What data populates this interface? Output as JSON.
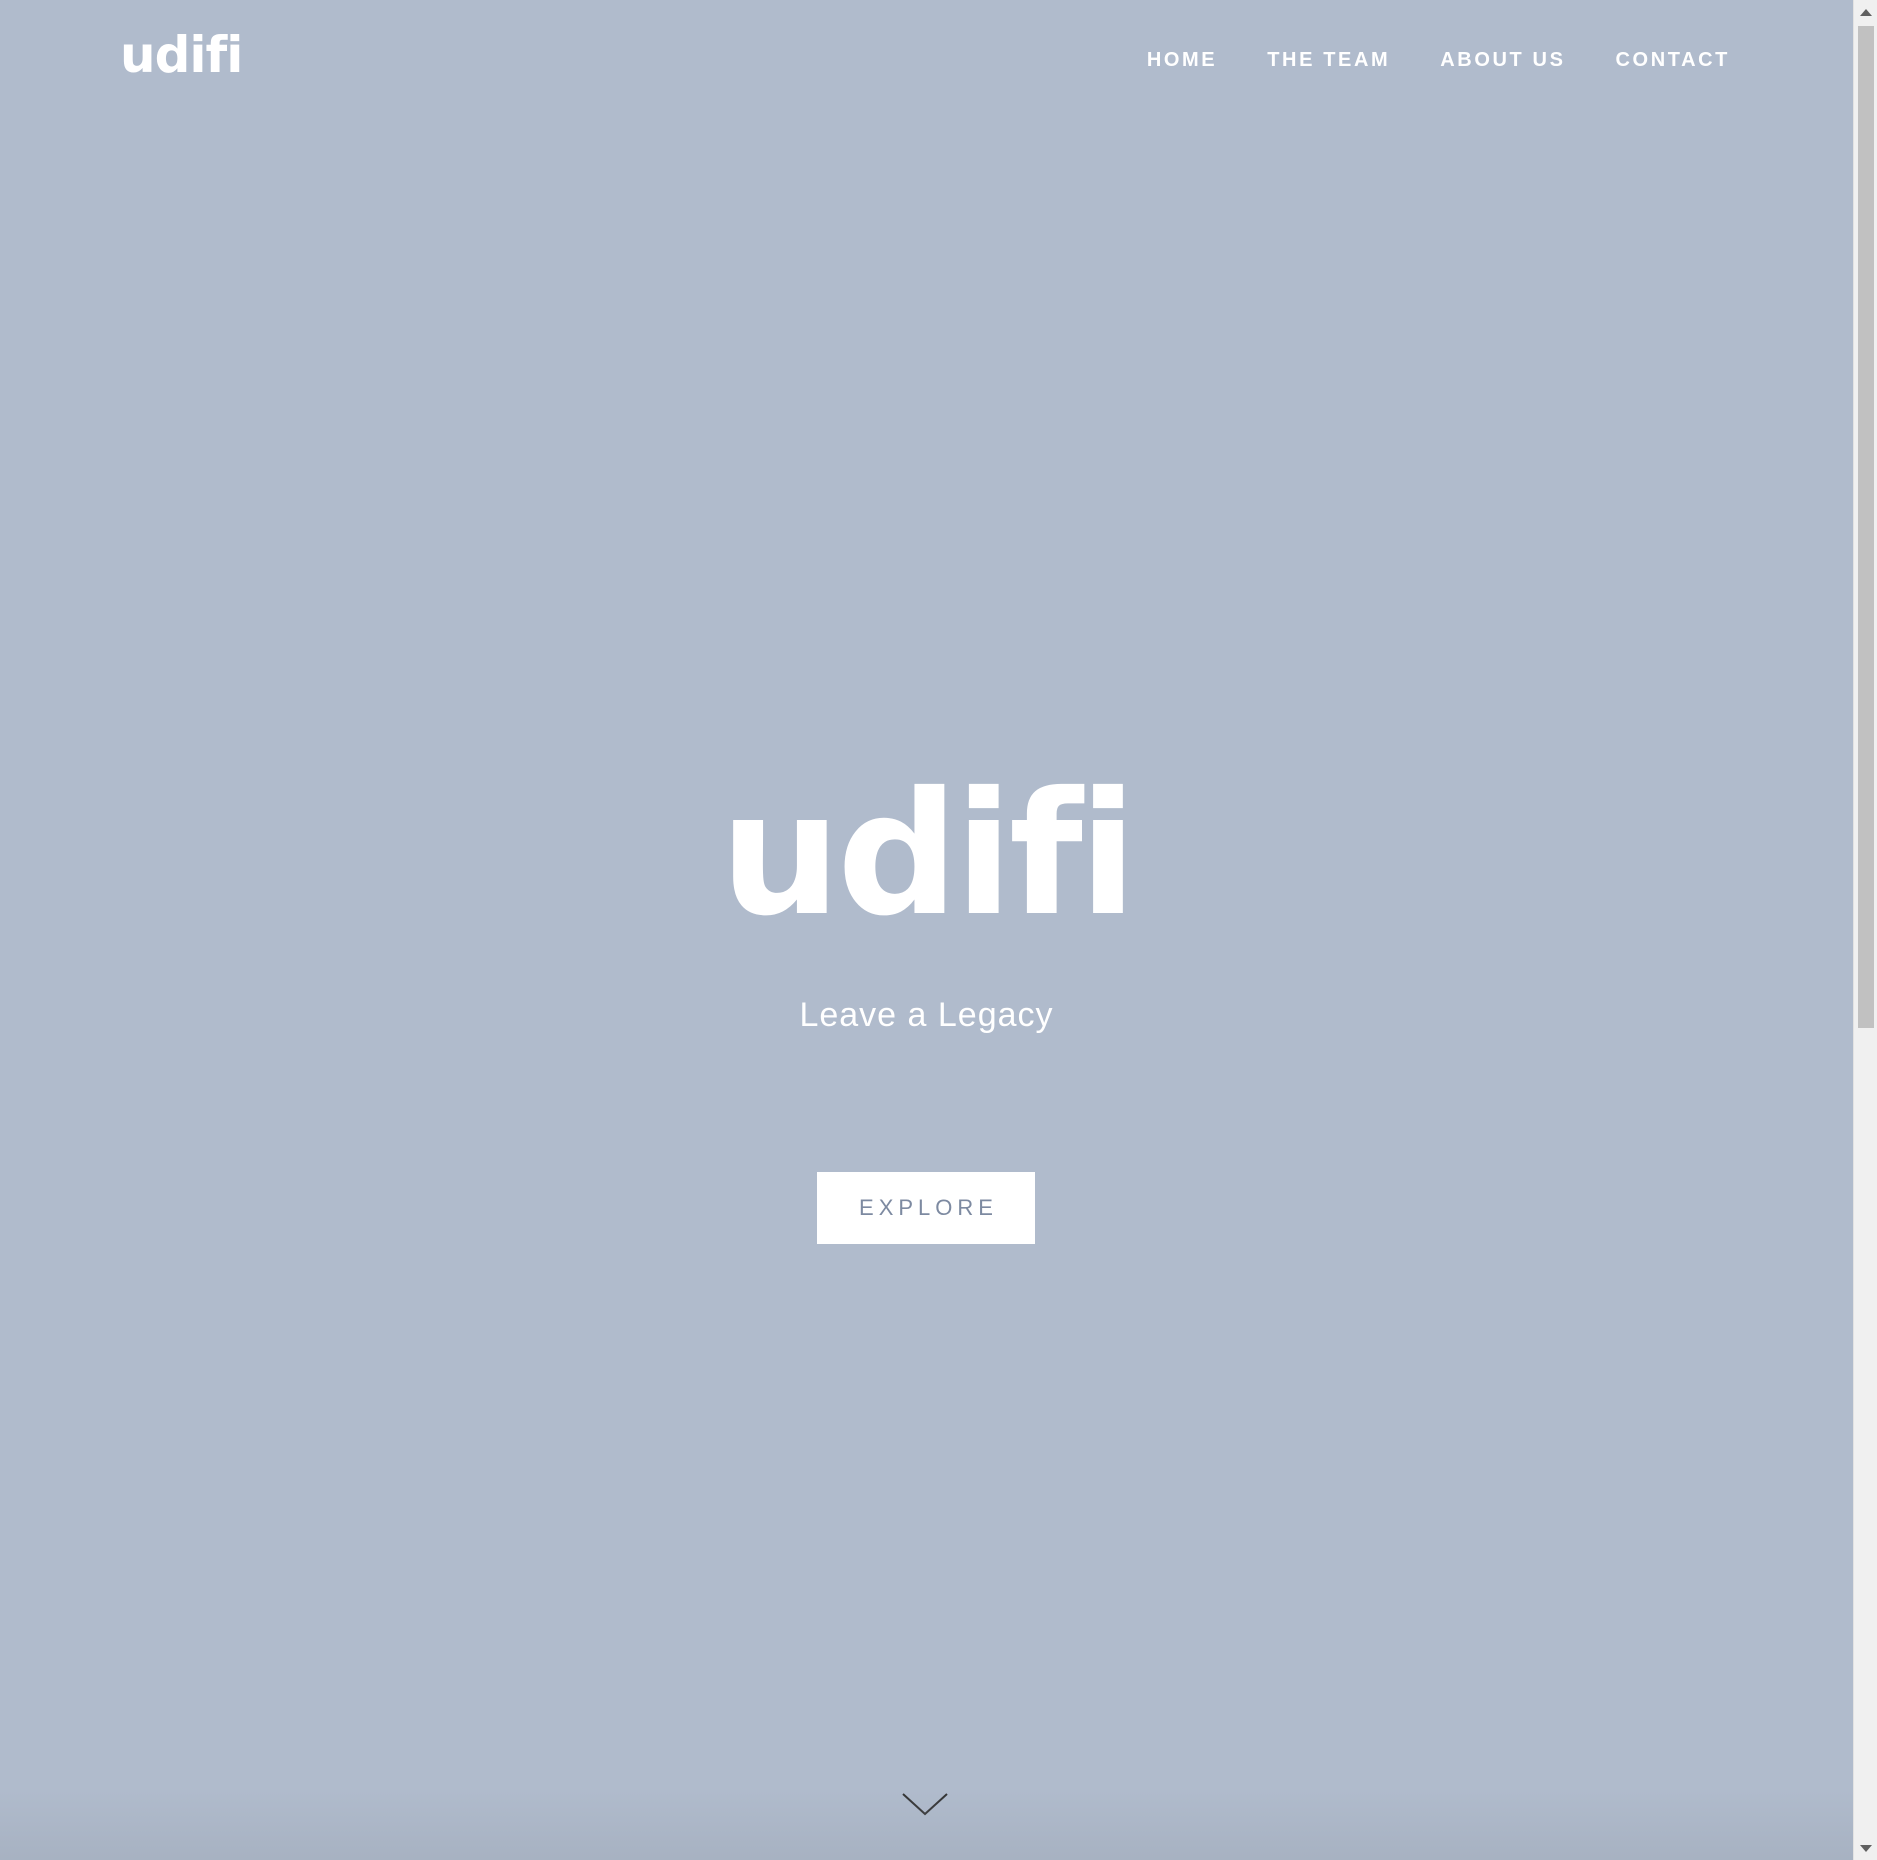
{
  "header": {
    "logo_text": "udifi",
    "nav": [
      {
        "label": "HOME"
      },
      {
        "label": "THE TEAM"
      },
      {
        "label": "ABOUT US"
      },
      {
        "label": "CONTACT"
      }
    ]
  },
  "hero": {
    "title": "udifi",
    "subtitle": "Leave a Legacy",
    "button_label": "EXPLORE",
    "scroll_icon": "chevron-down-icon"
  },
  "colors": {
    "background": "#b0bbcc",
    "text": "#ffffff",
    "button_text": "#7d8aa1",
    "chevron": "#333333"
  }
}
